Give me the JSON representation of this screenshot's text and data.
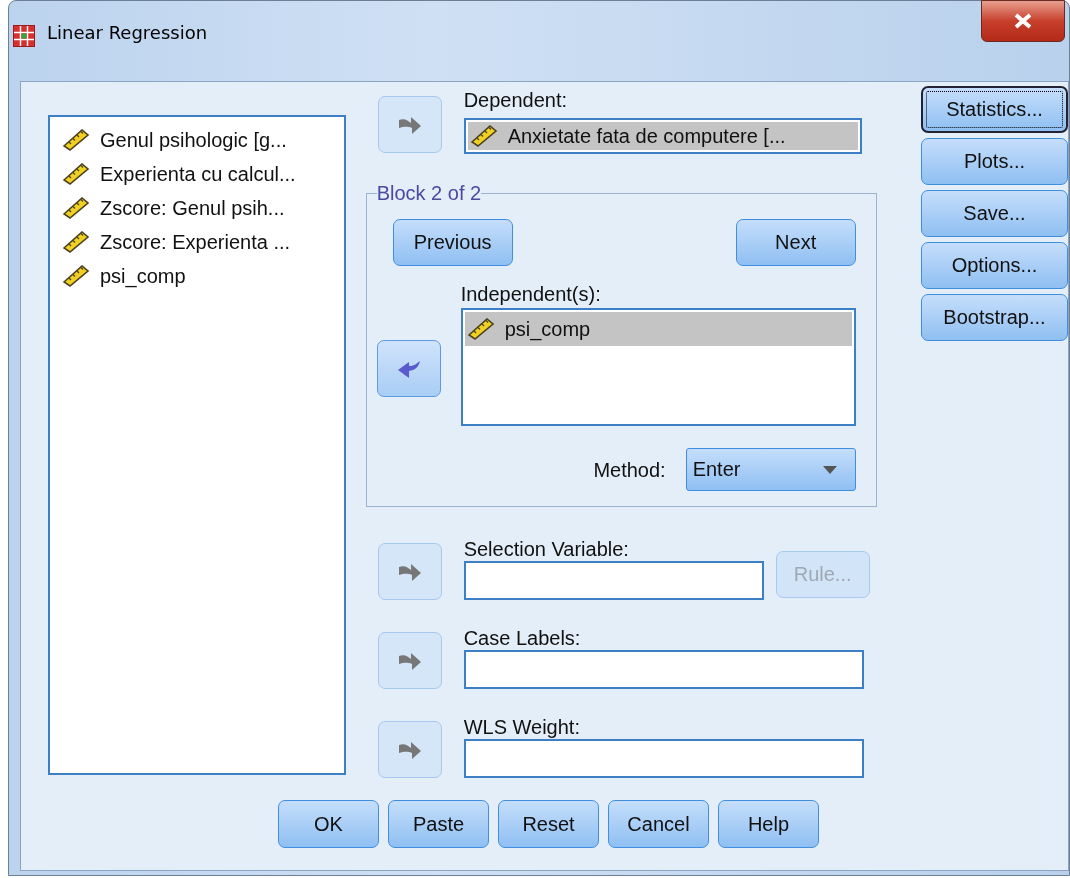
{
  "window": {
    "title": "Linear Regression"
  },
  "variables": [
    {
      "label": "Genul psihologic [g...",
      "selected": false
    },
    {
      "label": "Experienta cu calcul...",
      "selected": false
    },
    {
      "label": "Zscore:  Genul psih...",
      "selected": false
    },
    {
      "label": "Zscore:  Experienta ...",
      "selected": false
    },
    {
      "label": "psi_comp",
      "selected": false
    }
  ],
  "dependent": {
    "label": "Dependent:",
    "arrow": {
      "kind": "right",
      "disabled": true
    },
    "value": "Anxietate fata de computere [...",
    "selected": true
  },
  "block": {
    "title": "Block 2 of 2",
    "previous": "Previous",
    "next": "Next",
    "independents_label": "Independent(s):",
    "arrow": {
      "kind": "left",
      "disabled": false
    },
    "independents": [
      {
        "label": "psi_comp",
        "selected": true
      }
    ],
    "method_label": "Method:",
    "method": "Enter"
  },
  "fields": [
    {
      "label": "Selection Variable:",
      "arrow": {
        "kind": "right",
        "disabled": true
      },
      "button": {
        "label": "Rule...",
        "disabled": true
      }
    },
    {
      "label": "Case Labels:",
      "arrow": {
        "kind": "right",
        "disabled": true
      }
    },
    {
      "label": "WLS Weight:",
      "arrow": {
        "kind": "right",
        "disabled": true
      }
    }
  ],
  "side_buttons": [
    {
      "label": "Statistics...",
      "focused": true
    },
    {
      "label": "Plots...",
      "focused": false
    },
    {
      "label": "Save...",
      "focused": false
    },
    {
      "label": "Options...",
      "focused": false
    },
    {
      "label": "Bootstrap...",
      "focused": false
    }
  ],
  "footer_buttons": [
    "OK",
    "Paste",
    "Reset",
    "Cancel",
    "Help"
  ]
}
